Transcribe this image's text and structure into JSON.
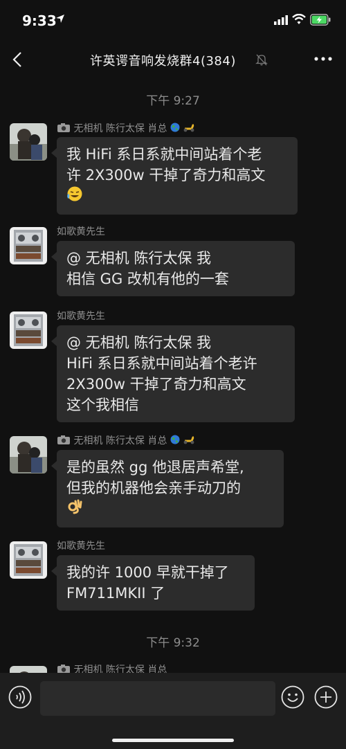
{
  "status_bar": {
    "time": "9:33"
  },
  "nav": {
    "title": "许英谔音响发烧群4(384)"
  },
  "timestamps": [
    "下午 9:27",
    "下午 9:32"
  ],
  "messages": [
    {
      "sender": "无相机 陈行太保 肖总",
      "lines": [
        "我 HiFi 系日系就中间站着个老",
        "许 2X300w 干掉了奇力和高文"
      ],
      "end_emoji": "laughing-tears-emoji"
    },
    {
      "sender": "如歌黄先生",
      "lines": [
        "@ 无相机 陈行太保 我",
        "相信 GG 改机有他的一套"
      ]
    },
    {
      "sender": "如歌黄先生",
      "lines": [
        "@ 无相机 陈行太保 我",
        "HiFi 系日系就中间站着个老许",
        "2X300w 干掉了奇力和高文",
        "这个我相信"
      ]
    },
    {
      "sender": "无相机 陈行太保 肖总",
      "lines": [
        "是的虽然 gg 他退居声希堂,",
        "但我的机器他会亲手动刀的"
      ],
      "end_emoji": "ok-hand-emoji"
    },
    {
      "sender": "如歌黄先生",
      "lines": [
        "我的许 1000 早就干掉了",
        "FM711MKII 了"
      ]
    },
    {
      "sender": "无相机 陈行太保 肖总"
    }
  ],
  "input": {
    "placeholder": ""
  },
  "colors": {
    "background": "#111111",
    "bubble": "#2c2c2c",
    "battery": "#4cd964"
  }
}
